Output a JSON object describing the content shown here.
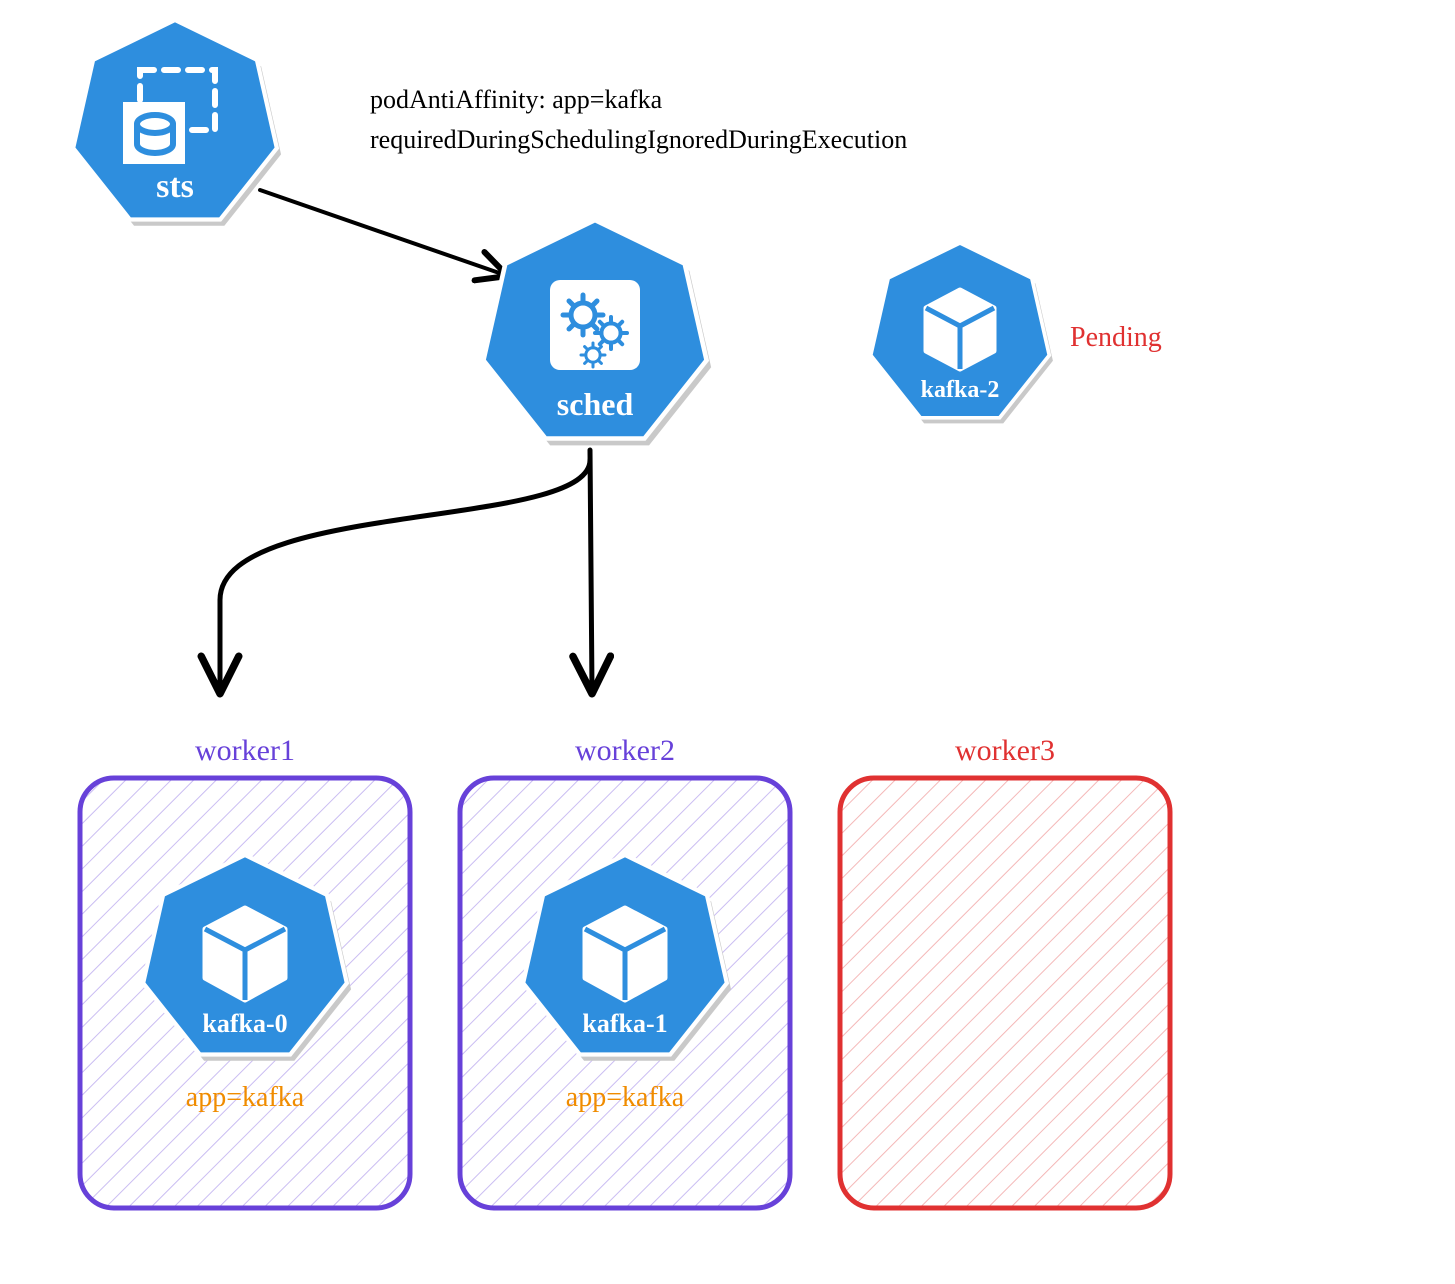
{
  "config": {
    "line1": "podAntiAffinity: app=kafka",
    "line2": "requiredDuringSchedulingIgnoredDuringExecution"
  },
  "icons": {
    "sts": {
      "label": "sts"
    },
    "sched": {
      "label": "sched"
    },
    "kafka2": {
      "label": "kafka-2",
      "status": "Pending"
    },
    "kafka0": {
      "label": "kafka-0"
    },
    "kafka1": {
      "label": "kafka-1"
    }
  },
  "workers": [
    {
      "name": "worker1",
      "app_label": "app=kafka",
      "color": "#6741d9"
    },
    {
      "name": "worker2",
      "app_label": "app=kafka",
      "color": "#6741d9"
    },
    {
      "name": "worker3",
      "app_label": "",
      "color": "#e03131"
    }
  ],
  "colors": {
    "k8s_blue": "#2e8ede",
    "shadow": "#c9c9c9",
    "purple": "#6741d9",
    "red": "#e03131",
    "orange": "#f08c00"
  }
}
